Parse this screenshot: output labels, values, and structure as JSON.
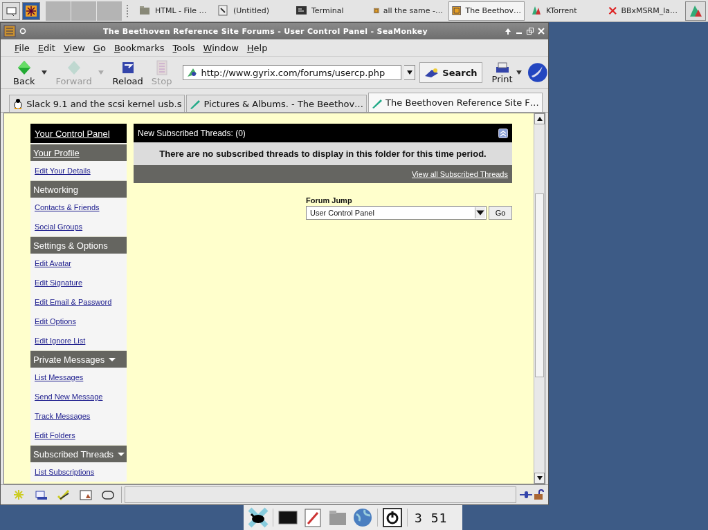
{
  "taskbar": {
    "tasks": [
      {
        "label": "HTML - File …",
        "selected": false
      },
      {
        "label": "(Untitled)",
        "selected": false
      },
      {
        "label": "Terminal",
        "selected": false
      },
      {
        "label": "all the same -…",
        "selected": false
      },
      {
        "label": "The Beethov…",
        "selected": true
      },
      {
        "label": "KTorrent",
        "selected": false
      },
      {
        "label": "BBxMSRM_la…",
        "selected": false
      }
    ]
  },
  "window": {
    "title": "The Beethoven Reference Site Forums - User Control Panel - SeaMonkey"
  },
  "menu": [
    "File",
    "Edit",
    "View",
    "Go",
    "Bookmarks",
    "Tools",
    "Window",
    "Help"
  ],
  "toolbar": {
    "buttons": [
      {
        "label": "Back",
        "disabled": false
      },
      {
        "label": "Forward",
        "disabled": true
      },
      {
        "label": "Reload",
        "disabled": false
      },
      {
        "label": "Stop",
        "disabled": true
      }
    ],
    "url": "http://www.gyrix.com/forums/usercp.php",
    "search": "Search",
    "print": "Print"
  },
  "tabs": [
    {
      "label": "Slack 9.1 and the scsi kernel usb.s",
      "selected": false
    },
    {
      "label": "Pictures & Albums. - The Beethov…",
      "selected": false
    },
    {
      "label": "The Beethoven Reference Site F…",
      "selected": true
    }
  ],
  "sidebar": {
    "title": "Your Control Panel",
    "sections": [
      {
        "heading": "Your Profile",
        "link": true,
        "collapsible": false,
        "items": [
          "Edit Your Details"
        ]
      },
      {
        "heading": "Networking",
        "link": false,
        "collapsible": false,
        "items": [
          "Contacts & Friends",
          "Social Groups"
        ]
      },
      {
        "heading": "Settings & Options",
        "link": false,
        "collapsible": false,
        "items": [
          "Edit Avatar",
          "Edit Signature",
          "Edit Email & Password",
          "Edit Options",
          "Edit Ignore List"
        ]
      },
      {
        "heading": "Private Messages",
        "link": false,
        "collapsible": true,
        "items": [
          "List Messages",
          "Send New Message",
          "Track Messages",
          "Edit Folders"
        ]
      },
      {
        "heading": "Subscribed Threads",
        "link": false,
        "collapsible": true,
        "items": [
          "List Subscriptions"
        ]
      }
    ]
  },
  "panel": {
    "title": "New Subscribed Threads: (0)",
    "message": "There are no subscribed threads to display in this folder for this time period.",
    "footer_link": "View all Subscribed Threads"
  },
  "forum_jump": {
    "label": "Forum Jump",
    "value": "User Control Panel",
    "button": "Go"
  },
  "clock": "3 51"
}
